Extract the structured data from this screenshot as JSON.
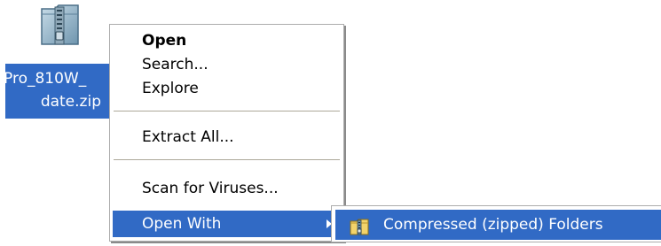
{
  "desktop_file": {
    "icon": "zip-folder-icon",
    "name_line1": "Pro_810W_",
    "name_line2": "date.zip"
  },
  "context_menu": {
    "items": [
      {
        "label": "Open",
        "bold": true
      },
      {
        "label": "Search..."
      },
      {
        "label": "Explore"
      },
      {
        "label": "Extract All..."
      },
      {
        "label": "Scan for Viruses..."
      },
      {
        "label": "Open With",
        "highlighted": true,
        "has_submenu": true
      }
    ]
  },
  "submenu": {
    "items": [
      {
        "label": "Compressed (zipped) Folders",
        "icon": "zip-folder-icon",
        "highlighted": true
      }
    ]
  },
  "colors": {
    "selection": "#316ac5",
    "background": "#ffffff"
  }
}
